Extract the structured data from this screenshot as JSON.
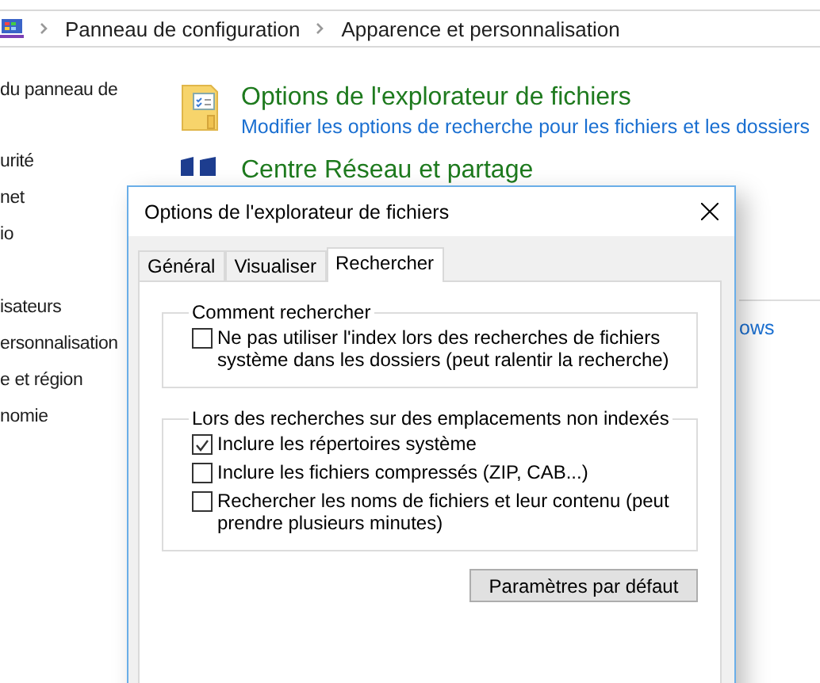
{
  "breadcrumb": [
    {
      "label": "Panneau de configuration"
    },
    {
      "label": "Apparence et personnalisation"
    }
  ],
  "sidebar": {
    "items": [
      {
        "label": "du panneau de"
      },
      {
        "label": "urité"
      },
      {
        "label": "net"
      },
      {
        "label": "io"
      },
      {
        "label": "isateurs"
      },
      {
        "label": "ersonnalisation"
      },
      {
        "label": "e et région"
      },
      {
        "label": "nomie"
      }
    ]
  },
  "categories": [
    {
      "kind": "folder",
      "title": "Options de l'explorateur de fichiers",
      "link": "Modifier les options de recherche pour les fichiers et les dossiers"
    },
    {
      "kind": "network",
      "title": "Centre Réseau et partage"
    }
  ],
  "partial_link": "ows",
  "dialog": {
    "title": "Options de l'explorateur de fichiers",
    "tabs": [
      {
        "label": "Général",
        "selected": false
      },
      {
        "label": "Visualiser",
        "selected": false
      },
      {
        "label": "Rechercher",
        "selected": true
      }
    ],
    "groups": [
      {
        "legend": "Comment rechercher",
        "options": [
          {
            "label": "Ne pas utiliser l'index lors des recherches de fichiers système dans les dossiers (peut ralentir la recherche)",
            "checked": false
          }
        ]
      },
      {
        "legend": "Lors des recherches sur des emplacements non indexés",
        "options": [
          {
            "label": "Inclure les répertoires système",
            "checked": true
          },
          {
            "label": "Inclure les fichiers compressés (ZIP, CAB...)",
            "checked": false
          },
          {
            "label": "Rechercher les noms de fichiers et leur contenu (peut prendre plusieurs minutes)",
            "checked": false
          }
        ]
      }
    ],
    "button": "Paramètres par défaut"
  }
}
